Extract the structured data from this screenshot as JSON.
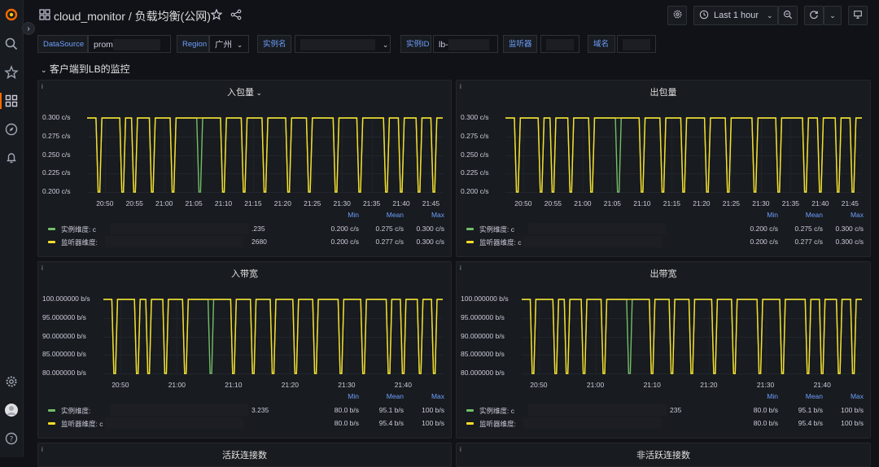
{
  "topbar": {
    "dashboard_folder": "cloud_monitor",
    "separator": "/",
    "dashboard_name": "负载均衡(公网)",
    "time_range": "Last 1 hour"
  },
  "variables": [
    {
      "label": "DataSource",
      "value": "prom"
    },
    {
      "label": "Region",
      "value": "广州"
    },
    {
      "label": "实例名",
      "value": ""
    },
    {
      "label": "实例ID",
      "value": "lb-"
    },
    {
      "label": "监听器",
      "value": ""
    },
    {
      "label": "域名",
      "value": ""
    }
  ],
  "row": {
    "title": "客户端到LB的监控"
  },
  "colors": {
    "green": "#73bf69",
    "yellow": "#fade2a",
    "accent": "#6e9fff",
    "logo": "#f46800"
  },
  "legend_headers": {
    "min": "Min",
    "mean": "Mean",
    "max": "Max"
  },
  "panels": [
    {
      "title": "入包量",
      "yticks": [
        "0.300 c/s",
        "0.275 c/s",
        "0.250 c/s",
        "0.225 c/s",
        "0.200 c/s"
      ],
      "xticks": [
        "20:50",
        "20:55",
        "21:00",
        "21:05",
        "21:10",
        "21:15",
        "21:20",
        "21:25",
        "21:30",
        "21:35",
        "21:40",
        "21:45"
      ],
      "legend": [
        {
          "label": "实例维度: c",
          "suffix": ".235",
          "min": "0.200 c/s",
          "mean": "0.275 c/s",
          "max": "0.300 c/s"
        },
        {
          "label": "监听器维度:",
          "suffix": "2680",
          "min": "0.200 c/s",
          "mean": "0.277 c/s",
          "max": "0.300 c/s"
        }
      ]
    },
    {
      "title": "出包量",
      "yticks": [
        "0.300 c/s",
        "0.275 c/s",
        "0.250 c/s",
        "0.225 c/s",
        "0.200 c/s"
      ],
      "xticks": [
        "20:50",
        "20:55",
        "21:00",
        "21:05",
        "21:10",
        "21:15",
        "21:20",
        "21:25",
        "21:30",
        "21:35",
        "21:40",
        "21:45"
      ],
      "legend": [
        {
          "label": "实例维度: c",
          "suffix": "",
          "min": "0.200 c/s",
          "mean": "0.275 c/s",
          "max": "0.300 c/s"
        },
        {
          "label": "监听器维度: c",
          "suffix": "",
          "min": "0.200 c/s",
          "mean": "0.277 c/s",
          "max": "0.300 c/s"
        }
      ]
    },
    {
      "title": "入带宽",
      "yticks": [
        "100.000000 b/s",
        "95.000000 b/s",
        "90.000000 b/s",
        "85.000000 b/s",
        "80.000000 b/s"
      ],
      "xticks": [
        "20:50",
        "21:00",
        "21:10",
        "21:20",
        "21:30",
        "21:40"
      ],
      "legend": [
        {
          "label": "实例维度:",
          "suffix": "3.235",
          "min": "80.0 b/s",
          "mean": "95.1 b/s",
          "max": "100 b/s"
        },
        {
          "label": "监听器维度: c",
          "suffix": "",
          "min": "80.0 b/s",
          "mean": "95.4 b/s",
          "max": "100 b/s"
        }
      ]
    },
    {
      "title": "出带宽",
      "yticks": [
        "100.000000 b/s",
        "95.000000 b/s",
        "90.000000 b/s",
        "85.000000 b/s",
        "80.000000 b/s"
      ],
      "xticks": [
        "20:50",
        "21:00",
        "21:10",
        "21:20",
        "21:30",
        "21:40"
      ],
      "legend": [
        {
          "label": "实例维度: c",
          "suffix": "235",
          "min": "80.0 b/s",
          "mean": "95.1 b/s",
          "max": "100 b/s"
        },
        {
          "label": "监听器维度:",
          "suffix": "",
          "min": "80.0 b/s",
          "mean": "95.4 b/s",
          "max": "100 b/s"
        }
      ]
    },
    {
      "title": "活跃连接数"
    },
    {
      "title": "非活跃连接数"
    }
  ],
  "chart_data": [
    {
      "type": "line",
      "title": "入包量",
      "ylim": [
        0.2,
        0.3
      ],
      "xlim": [
        "20:47",
        "21:47"
      ],
      "series": [
        {
          "name": "实例维度",
          "min": 0.2,
          "mean": 0.275,
          "max": 0.3,
          "dips": [
            [
              "20:48:30",
              "20:49:30"
            ],
            [
              "20:52:30",
              "20:53:30"
            ],
            [
              "20:54:30",
              "20:55:30"
            ],
            [
              "20:57:30",
              "20:58:30"
            ],
            [
              "21:01:00",
              "21:02:00"
            ],
            [
              "21:05:30",
              "21:06:30"
            ],
            [
              "21:09:30",
              "21:10:30"
            ],
            [
              "21:13:00",
              "21:14:00"
            ],
            [
              "21:16:30",
              "21:17:30"
            ],
            [
              "21:20:30",
              "21:21:30"
            ],
            [
              "21:24:00",
              "21:25:00"
            ],
            [
              "21:28:30",
              "21:29:30"
            ],
            [
              "21:32:30",
              "21:33:30"
            ],
            [
              "21:37:00",
              "21:38:00"
            ],
            [
              "21:39:30",
              "21:40:30"
            ],
            [
              "21:42:30",
              "21:43:30"
            ],
            [
              "21:45:00",
              "21:46:00"
            ]
          ]
        },
        {
          "name": "监听器维度",
          "min": 0.2,
          "mean": 0.277,
          "max": 0.3,
          "dips": [
            [
              "20:48:30",
              "20:49:30"
            ],
            [
              "20:52:30",
              "20:53:30"
            ],
            [
              "20:54:30",
              "20:55:30"
            ],
            [
              "20:57:30",
              "20:58:30"
            ],
            [
              "21:01:00",
              "21:02:00"
            ],
            [
              "21:09:30",
              "21:10:30"
            ],
            [
              "21:13:00",
              "21:14:00"
            ],
            [
              "21:16:30",
              "21:17:30"
            ],
            [
              "21:20:30",
              "21:21:30"
            ],
            [
              "21:24:00",
              "21:25:00"
            ],
            [
              "21:28:30",
              "21:29:30"
            ],
            [
              "21:32:30",
              "21:33:30"
            ],
            [
              "21:37:00",
              "21:38:00"
            ],
            [
              "21:39:30",
              "21:40:30"
            ],
            [
              "21:42:30",
              "21:43:30"
            ],
            [
              "21:45:00",
              "21:46:00"
            ]
          ]
        }
      ]
    },
    {
      "type": "line",
      "title": "出包量",
      "ylim": [
        0.2,
        0.3
      ],
      "xlim": [
        "20:47",
        "21:47"
      ],
      "series": [
        {
          "name": "实例维度",
          "min": 0.2,
          "mean": 0.275,
          "max": 0.3,
          "dips": [
            [
              "20:48:30",
              "20:49:30"
            ],
            [
              "20:52:30",
              "20:53:30"
            ],
            [
              "20:54:30",
              "20:55:30"
            ],
            [
              "20:57:30",
              "20:58:30"
            ],
            [
              "21:01:00",
              "21:02:00"
            ],
            [
              "21:05:30",
              "21:06:30"
            ],
            [
              "21:09:30",
              "21:10:30"
            ],
            [
              "21:13:00",
              "21:14:00"
            ],
            [
              "21:16:30",
              "21:17:30"
            ],
            [
              "21:20:30",
              "21:21:30"
            ],
            [
              "21:24:00",
              "21:25:00"
            ],
            [
              "21:28:30",
              "21:29:30"
            ],
            [
              "21:32:30",
              "21:33:30"
            ],
            [
              "21:37:00",
              "21:38:00"
            ],
            [
              "21:39:30",
              "21:40:30"
            ],
            [
              "21:42:30",
              "21:43:30"
            ],
            [
              "21:45:00",
              "21:46:00"
            ]
          ]
        },
        {
          "name": "监听器维度",
          "min": 0.2,
          "mean": 0.277,
          "max": 0.3,
          "dips": [
            [
              "20:48:30",
              "20:49:30"
            ],
            [
              "20:52:30",
              "20:53:30"
            ],
            [
              "20:54:30",
              "20:55:30"
            ],
            [
              "20:57:30",
              "20:58:30"
            ],
            [
              "21:01:00",
              "21:02:00"
            ],
            [
              "21:09:30",
              "21:10:30"
            ],
            [
              "21:13:00",
              "21:14:00"
            ],
            [
              "21:16:30",
              "21:17:30"
            ],
            [
              "21:20:30",
              "21:21:30"
            ],
            [
              "21:24:00",
              "21:25:00"
            ],
            [
              "21:28:30",
              "21:29:30"
            ],
            [
              "21:32:30",
              "21:33:30"
            ],
            [
              "21:37:00",
              "21:38:00"
            ],
            [
              "21:39:30",
              "21:40:30"
            ],
            [
              "21:42:30",
              "21:43:30"
            ],
            [
              "21:45:00",
              "21:46:00"
            ]
          ]
        }
      ]
    },
    {
      "type": "line",
      "title": "入带宽",
      "ylim": [
        80,
        100
      ],
      "xlim": [
        "20:47",
        "21:47"
      ],
      "series": [
        {
          "name": "实例维度",
          "min": 80.0,
          "mean": 95.1,
          "max": 100,
          "dips": [
            [
              "20:48:30",
              "20:49:30"
            ],
            [
              "20:52:30",
              "20:53:30"
            ],
            [
              "20:54:30",
              "20:55:30"
            ],
            [
              "20:57:30",
              "20:58:30"
            ],
            [
              "21:01:00",
              "21:02:00"
            ],
            [
              "21:05:30",
              "21:06:30"
            ],
            [
              "21:09:30",
              "21:10:30"
            ],
            [
              "21:13:00",
              "21:14:00"
            ],
            [
              "21:16:30",
              "21:17:30"
            ],
            [
              "21:20:30",
              "21:21:30"
            ],
            [
              "21:24:00",
              "21:25:00"
            ],
            [
              "21:28:30",
              "21:29:30"
            ],
            [
              "21:32:30",
              "21:33:30"
            ],
            [
              "21:37:00",
              "21:38:00"
            ],
            [
              "21:39:30",
              "21:40:30"
            ],
            [
              "21:42:30",
              "21:43:30"
            ],
            [
              "21:45:00",
              "21:46:00"
            ]
          ]
        },
        {
          "name": "监听器维度",
          "min": 80.0,
          "mean": 95.4,
          "max": 100,
          "dips": [
            [
              "20:48:30",
              "20:49:30"
            ],
            [
              "20:52:30",
              "20:53:30"
            ],
            [
              "20:54:30",
              "20:55:30"
            ],
            [
              "20:57:30",
              "20:58:30"
            ],
            [
              "21:01:00",
              "21:02:00"
            ],
            [
              "21:09:30",
              "21:10:30"
            ],
            [
              "21:13:00",
              "21:14:00"
            ],
            [
              "21:16:30",
              "21:17:30"
            ],
            [
              "21:20:30",
              "21:21:30"
            ],
            [
              "21:24:00",
              "21:25:00"
            ],
            [
              "21:28:30",
              "21:29:30"
            ],
            [
              "21:32:30",
              "21:33:30"
            ],
            [
              "21:37:00",
              "21:38:00"
            ],
            [
              "21:39:30",
              "21:40:30"
            ],
            [
              "21:42:30",
              "21:43:30"
            ],
            [
              "21:45:00",
              "21:46:00"
            ]
          ]
        }
      ]
    },
    {
      "type": "line",
      "title": "出带宽",
      "ylim": [
        80,
        100
      ],
      "xlim": [
        "20:47",
        "21:47"
      ],
      "series": [
        {
          "name": "实例维度",
          "min": 80.0,
          "mean": 95.1,
          "max": 100,
          "dips": [
            [
              "20:48:30",
              "20:49:30"
            ],
            [
              "20:52:30",
              "20:53:30"
            ],
            [
              "20:54:30",
              "20:55:30"
            ],
            [
              "20:57:30",
              "20:58:30"
            ],
            [
              "21:01:00",
              "21:02:00"
            ],
            [
              "21:05:30",
              "21:06:30"
            ],
            [
              "21:09:30",
              "21:10:30"
            ],
            [
              "21:13:00",
              "21:14:00"
            ],
            [
              "21:16:30",
              "21:17:30"
            ],
            [
              "21:20:30",
              "21:21:30"
            ],
            [
              "21:24:00",
              "21:25:00"
            ],
            [
              "21:28:30",
              "21:29:30"
            ],
            [
              "21:32:30",
              "21:33:30"
            ],
            [
              "21:37:00",
              "21:38:00"
            ],
            [
              "21:39:30",
              "21:40:30"
            ],
            [
              "21:42:30",
              "21:43:30"
            ],
            [
              "21:45:00",
              "21:46:00"
            ]
          ]
        },
        {
          "name": "监听器维度",
          "min": 80.0,
          "mean": 95.4,
          "max": 100,
          "dips": [
            [
              "20:48:30",
              "20:49:30"
            ],
            [
              "20:52:30",
              "20:53:30"
            ],
            [
              "20:54:30",
              "20:55:30"
            ],
            [
              "20:57:30",
              "20:58:30"
            ],
            [
              "21:01:00",
              "21:02:00"
            ],
            [
              "21:09:30",
              "21:10:30"
            ],
            [
              "21:13:00",
              "21:14:00"
            ],
            [
              "21:16:30",
              "21:17:30"
            ],
            [
              "21:20:30",
              "21:21:30"
            ],
            [
              "21:24:00",
              "21:25:00"
            ],
            [
              "21:28:30",
              "21:29:30"
            ],
            [
              "21:32:30",
              "21:33:30"
            ],
            [
              "21:37:00",
              "21:38:00"
            ],
            [
              "21:39:30",
              "21:40:30"
            ],
            [
              "21:42:30",
              "21:43:30"
            ],
            [
              "21:45:00",
              "21:46:00"
            ]
          ]
        }
      ]
    }
  ]
}
